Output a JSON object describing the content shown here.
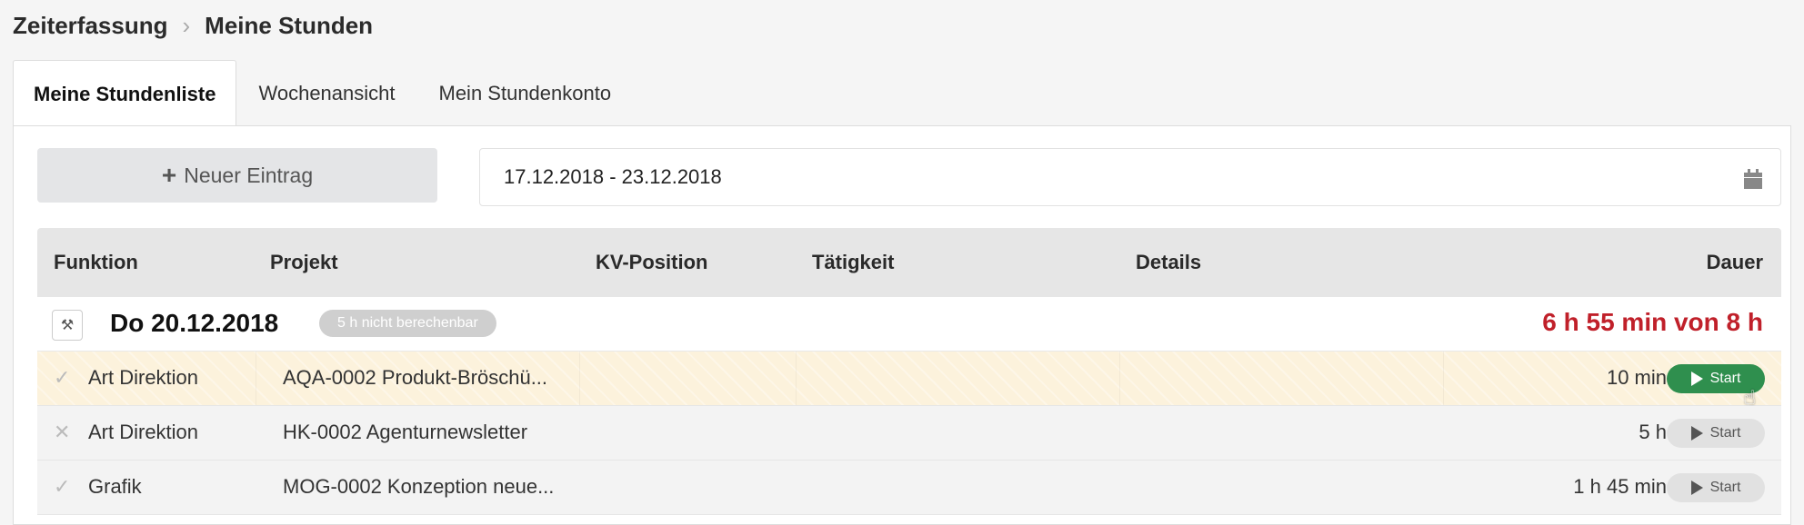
{
  "breadcrumb": {
    "parent": "Zeiterfassung",
    "current": "Meine Stunden"
  },
  "tabs": [
    {
      "label": "Meine Stundenliste"
    },
    {
      "label": "Wochenansicht"
    },
    {
      "label": "Mein Stundenkonto"
    }
  ],
  "toolbar": {
    "new_entry_label": "Neuer Eintrag",
    "date_range": "17.12.2018 - 23.12.2018"
  },
  "table": {
    "headers": {
      "funktion": "Funktion",
      "projekt": "Projekt",
      "kv_position": "KV-Position",
      "taetigkeit": "Tätigkeit",
      "details": "Details",
      "dauer": "Dauer"
    },
    "day": {
      "title": "Do 20.12.2018",
      "badge": "5 h nicht berechenbar",
      "total": "6 h 55 min von 8 h"
    },
    "rows": [
      {
        "status": "✓",
        "funktion": "Art Direktion",
        "projekt": "AQA-0002 Produkt-Bröschü...",
        "dauer": "10 min",
        "start": "Start"
      },
      {
        "status": "✕",
        "funktion": "Art Direktion",
        "projekt": "HK-0002 Agenturnewsletter",
        "dauer": "5 h",
        "start": "Start"
      },
      {
        "status": "✓",
        "funktion": "Grafik",
        "projekt": "MOG-0002 Konzeption neue...",
        "dauer": "1 h 45 min",
        "start": "Start"
      }
    ]
  },
  "colors": {
    "accent_green": "#2f8f4e",
    "total_red": "#c0202a",
    "highlight_row": "#fcf2dc"
  }
}
